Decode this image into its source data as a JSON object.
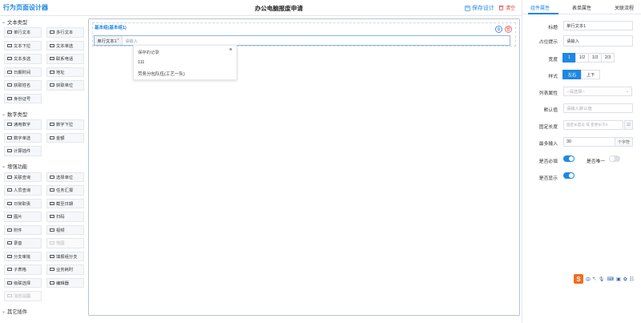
{
  "header": {
    "app_title": "行为页面设计器",
    "doc_title": "办公电脑报废申请",
    "save_label": "保存设计",
    "clear_label": "清空"
  },
  "palette": {
    "groups": [
      {
        "title": "文本类型",
        "items": [
          "单行文本",
          "多行文本",
          "文本下拉",
          "文本单选",
          "文本多选",
          "联系电话",
          "日期时间",
          "地址",
          "获取姓名",
          "获取单位",
          "身份证号"
        ],
        "disabled": []
      },
      {
        "title": "数字类型",
        "items": [
          "通用数字",
          "数字下拉",
          "数字单选",
          "金额",
          "计算插件"
        ],
        "disabled": []
      },
      {
        "title": "增强功能",
        "items": [
          "关联查询",
          "选择单位",
          "人员查询",
          "任务汇报",
          "日常职责",
          "截至日期",
          "图片",
          "扫码",
          "附件",
          "视频",
          "录音",
          "地图",
          "分支审批",
          "填报组分支",
          "子表格",
          "业务耗时",
          "级联选择",
          "编辑器",
          "消息提醒"
        ],
        "disabled": [
          "地图",
          "消息提醒"
        ]
      },
      {
        "title": "其它插件",
        "items": [],
        "disabled": []
      }
    ]
  },
  "canvas": {
    "section_title": "基本组(基本组1)",
    "field_label": "单行文本1",
    "field_required_mark": "*",
    "field_placeholder": "请输入"
  },
  "dropdown": {
    "header": "保存的记录",
    "close_symbol": "×",
    "items": [
      "111",
      "劳务分包队伍(工艺一队)"
    ]
  },
  "right_panel": {
    "tabs": [
      "组件属性",
      "表单属性",
      "关联流程"
    ],
    "active_tab": "组件属性",
    "props": {
      "title_label": "标题",
      "title_value": "单行文本1",
      "placeholder_label": "占位提示",
      "placeholder_value": "请输入",
      "width_label": "宽度",
      "width_options": [
        "1",
        "1/2",
        "1/3",
        "2/3"
      ],
      "width_selected": "1",
      "style_label": "样式",
      "style_options": [
        "左右",
        "上下"
      ],
      "style_selected": "左右",
      "list_prop_label": "列表属性",
      "list_prop_placeholder": "--请选择--",
      "default_label": "默认值",
      "default_placeholder": "请输入默认值",
      "fixed_len_label": "固定长度",
      "fixed_len_placeholder": "固定长度过 或 变更长于3",
      "max_input_label": "最多输入",
      "max_input_value": "30",
      "max_input_suffix": "个字符",
      "required_label": "是否必填",
      "required_on": true,
      "unique_label": "是否唯一",
      "unique_on": false,
      "show_label": "是否显示",
      "show_on": true
    }
  },
  "ime": {
    "logo": "S",
    "lang": "中",
    "icons": [
      "punctuation-icon",
      "mic-icon",
      "keyboard-icon",
      "skin-icon",
      "toolbox-icon",
      "menu-icon"
    ]
  }
}
